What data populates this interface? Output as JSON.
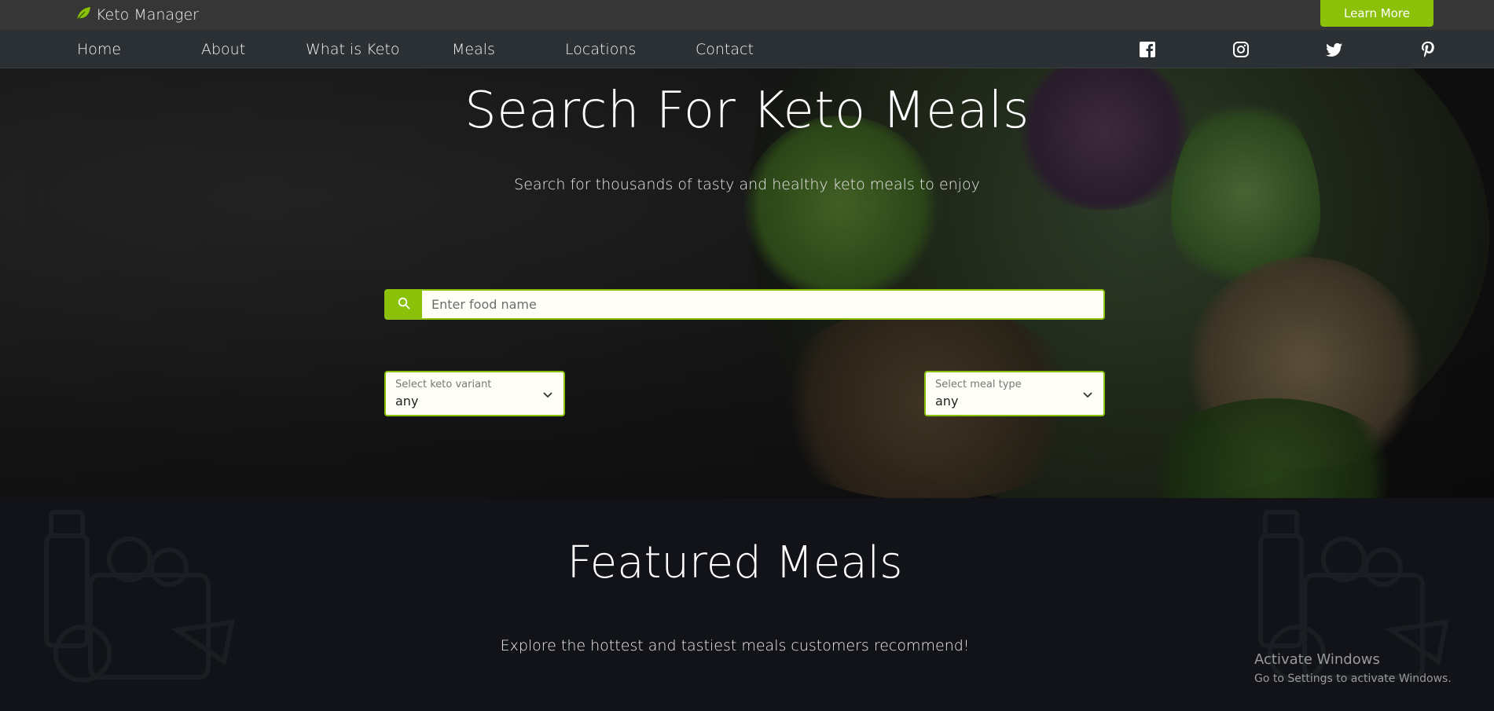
{
  "header": {
    "brand": "Keto Manager",
    "learn_more": "Learn More"
  },
  "nav": {
    "items": [
      "Home",
      "About",
      "What is Keto",
      "Meals",
      "Locations",
      "Contact"
    ],
    "social": [
      "facebook-icon",
      "instagram-icon",
      "twitter-icon",
      "pinterest-icon"
    ]
  },
  "hero": {
    "title": "Search For Keto Meals",
    "subtitle": "Search for thousands of tasty and healthy keto meals to enjoy",
    "search_placeholder": "Enter food name",
    "keto_variant": {
      "label": "Select keto variant",
      "value": "any"
    },
    "meal_type": {
      "label": "Select meal type",
      "value": "any"
    }
  },
  "featured": {
    "title": "Featured Meals",
    "subtitle": "Explore the hottest and tastiest meals customers recommend!"
  },
  "watermark": {
    "line1": "Activate Windows",
    "line2": "Go to Settings to activate Windows."
  },
  "colors": {
    "accent": "#8cc10a",
    "topbar": "#363636",
    "navbar": "#2b3035",
    "featured_bg": "#111318"
  }
}
